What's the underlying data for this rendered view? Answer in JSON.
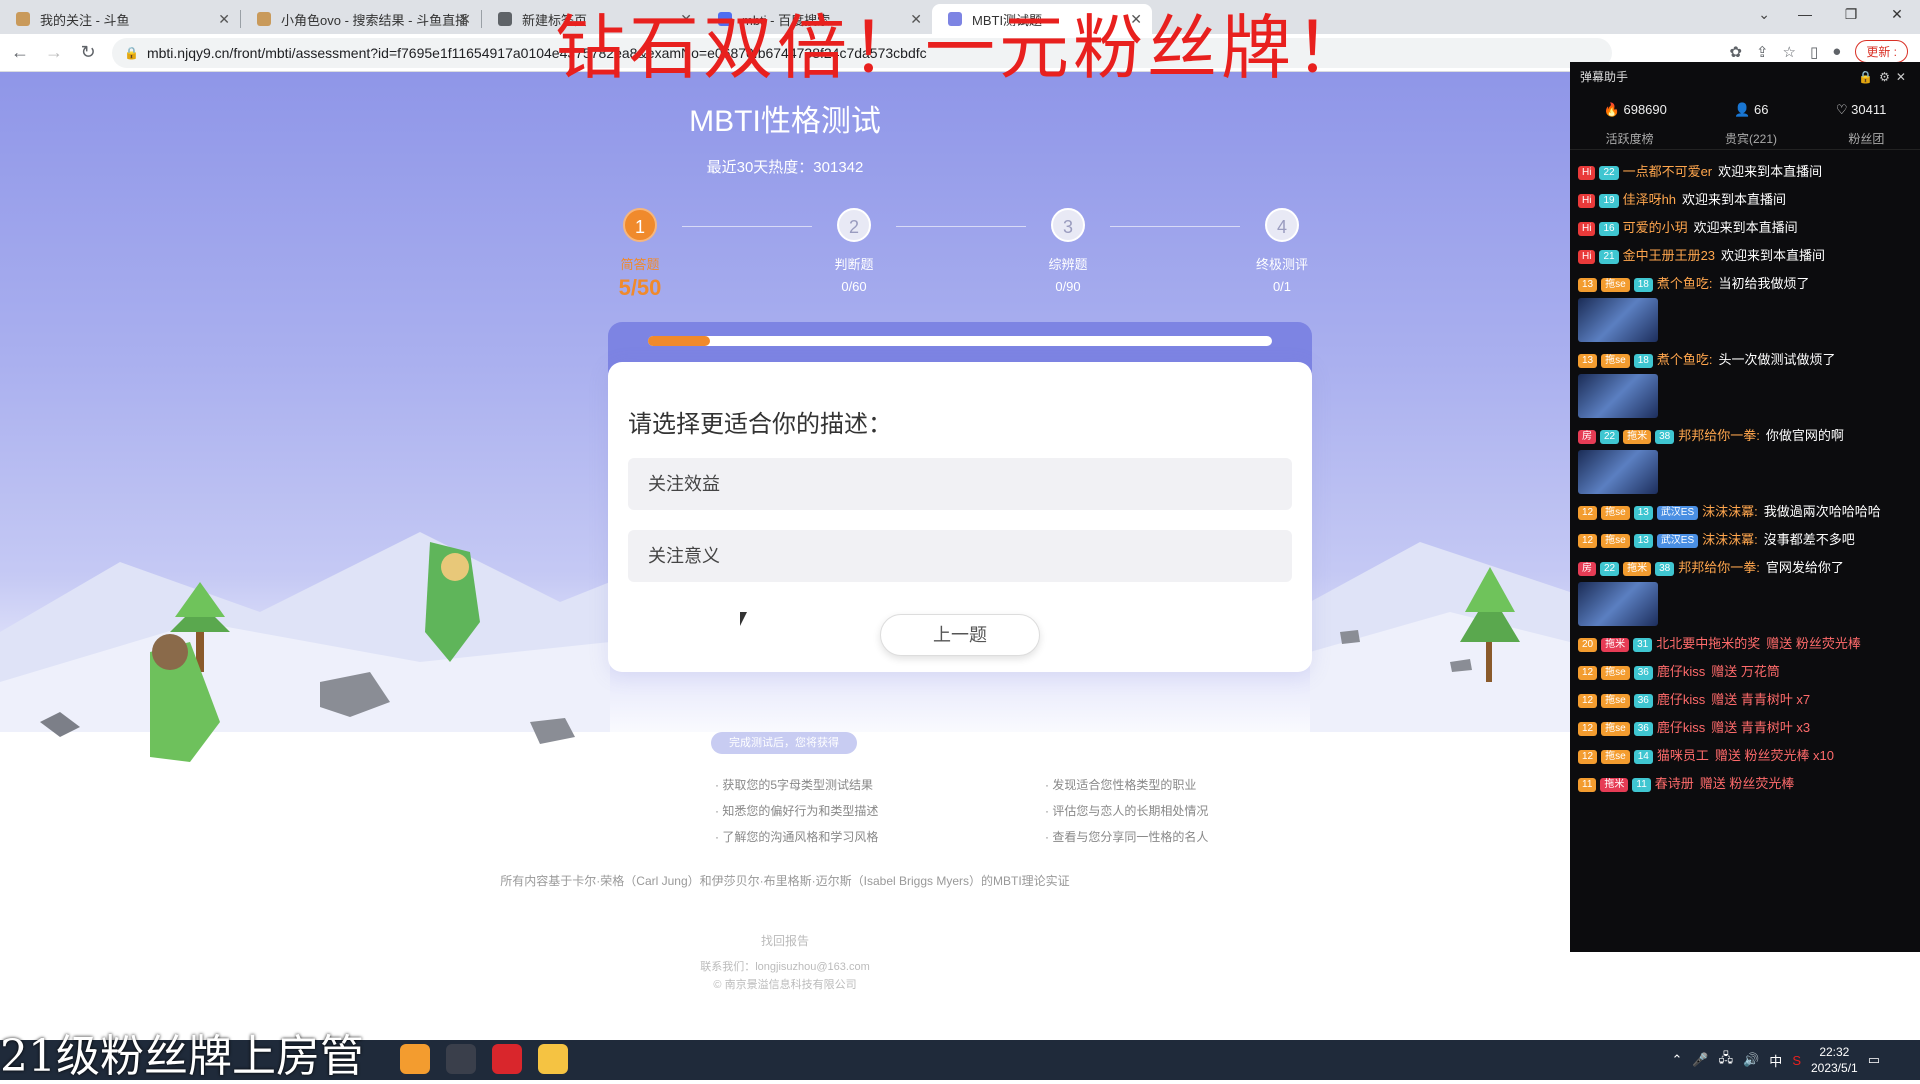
{
  "browser": {
    "tabs": [
      {
        "title": "我的关注 - 斗鱼",
        "active": false
      },
      {
        "title": "小角色ovo - 搜索结果 - 斗鱼直播",
        "active": false
      },
      {
        "title": "新建标签页",
        "active": false
      },
      {
        "title": "mbti - 百度搜索",
        "active": false
      },
      {
        "title": "MBTI测试题",
        "active": true
      }
    ],
    "url": "mbti.njqy9.cn/front/mbti/assessment?id=f7695e1f11654917a0104e4375782ea8&examNo=e06870fb6744738f24c7da573cbdfc",
    "update_label": "更新 :"
  },
  "overlay": {
    "top_text": "钻石双倍！一元粉丝牌！",
    "bottom_text": "21级粉丝牌上房管"
  },
  "page": {
    "title": "MBTI性格测试",
    "hotness": "最近30天热度：301342",
    "steps": [
      {
        "num": "1",
        "name": "简答题",
        "progress": "5/50",
        "active": true
      },
      {
        "num": "2",
        "name": "判断题",
        "progress": "0/60",
        "active": false
      },
      {
        "num": "3",
        "name": "综辨题",
        "progress": "0/90",
        "active": false
      },
      {
        "num": "4",
        "name": "终极测评",
        "progress": "0/1",
        "active": false
      }
    ],
    "progress_fraction": 0.1,
    "question": "请选择更适合你的描述：",
    "options": [
      "关注效益",
      "关注意义"
    ],
    "prev_button": "上一题",
    "benefits_tag": "完成测试后，您将获得",
    "benefits_left": [
      "获取您的5字母类型测试结果",
      "知悉您的偏好行为和类型描述",
      "了解您的沟通风格和学习风格"
    ],
    "benefits_right": [
      "发现适合您性格类型的职业",
      "评估您与恋人的长期相处情况",
      "查看与您分享同一性格的名人"
    ],
    "based_on": "所有内容基于卡尔·荣格（Carl Jung）和伊莎贝尔·布里格斯·迈尔斯（Isabel Briggs Myers）的MBTI理论实证",
    "find_report": "找回报告",
    "contact": "联系我们：longjisuzhou@163.com",
    "copyright": "© 南京景溢信息科技有限公司"
  },
  "danmaku": {
    "title": "弹幕助手",
    "stats": {
      "hot": "698690",
      "users": "66",
      "likes": "30411"
    },
    "tabs": [
      "活跃度榜",
      "贵宾(221)",
      "粉丝团"
    ],
    "messages": [
      {
        "badges": [
          "Hi",
          "22"
        ],
        "user": "一点都不可爱er",
        "text": "欢迎来到本直播间"
      },
      {
        "badges": [
          "Hi",
          "19"
        ],
        "user": "佳泽呀hh",
        "text": "欢迎来到本直播间"
      },
      {
        "badges": [
          "Hi",
          "16"
        ],
        "user": "可爱的小玥",
        "text": "欢迎来到本直播间"
      },
      {
        "badges": [
          "Hi",
          "21"
        ],
        "user": "金中王册王册23",
        "text": "欢迎来到本直播间"
      },
      {
        "badges": [
          "13",
          "拖se",
          "18"
        ],
        "user": "煮个鱼吃:",
        "text": "当初给我做烦了",
        "thumb": true
      },
      {
        "badges": [
          "13",
          "拖se",
          "18"
        ],
        "user": "煮个鱼吃:",
        "text": "头一次做测试做烦了",
        "thumb": true
      },
      {
        "badges": [
          "房",
          "22",
          "拖米",
          "38"
        ],
        "user": "邦邦给你一拳:",
        "text": "你做官网的啊",
        "thumb": true
      },
      {
        "badges": [
          "12",
          "拖se",
          "13",
          "武汉ES"
        ],
        "user": "沫沫沫冪:",
        "text": "我做過兩次哈哈哈哈"
      },
      {
        "badges": [
          "12",
          "拖se",
          "13",
          "武汉ES"
        ],
        "user": "沫沫沫冪:",
        "text": "沒事都差不多吧"
      },
      {
        "badges": [
          "房",
          "22",
          "拖米",
          "38"
        ],
        "user": "邦邦给你一拳:",
        "text": "官网发给你了",
        "thumb": true
      },
      {
        "badges": [
          "20",
          "拖米",
          "31"
        ],
        "user": "北北要中拖米的奖",
        "gift": "赠送 粉丝荧光棒"
      },
      {
        "badges": [
          "12",
          "拖se",
          "36"
        ],
        "user": "鹿仔kiss",
        "gift": "赠送 万花筒"
      },
      {
        "badges": [
          "12",
          "拖se",
          "36"
        ],
        "user": "鹿仔kiss",
        "gift": "赠送 青青树叶 x7"
      },
      {
        "badges": [
          "12",
          "拖se",
          "36"
        ],
        "user": "鹿仔kiss",
        "gift": "赠送 青青树叶 x3"
      },
      {
        "badges": [
          "12",
          "拖se",
          "14"
        ],
        "user": "猫咪员工",
        "gift": "赠送 粉丝荧光棒 x10"
      },
      {
        "badges": [
          "11",
          "拖米",
          "11"
        ],
        "user": "春诗册",
        "gift": "赠送 粉丝荧光棒"
      }
    ]
  },
  "taskbar": {
    "ime": "中",
    "time": "22:32",
    "date": "2023/5/1"
  }
}
